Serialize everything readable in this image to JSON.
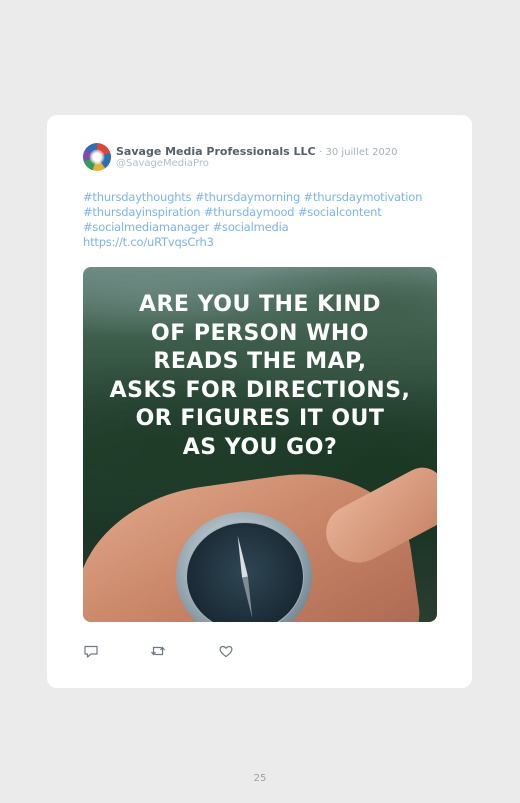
{
  "tweet": {
    "author_name": "Savage Media Professionals LLC",
    "date": "· 30 juillet 2020",
    "handle": "@SavageMediaPro",
    "text_lines": [
      "#thursdaythoughts #thursdaymorning #thursdaymotivation",
      "#thursdayinspiration #thursdaymood #socialcontent",
      "#socialmediamanager #socialmedia",
      "https://t.co/uRTvqsCrh3"
    ],
    "image_caption_lines": [
      "ARE YOU THE KIND",
      "OF PERSON WHO",
      "READS THE MAP,",
      "ASKS FOR DIRECTIONS,",
      "OR FIGURES IT OUT",
      "AS YOU GO?"
    ],
    "actions": {
      "reply_icon": "reply-icon",
      "retweet_icon": "retweet-icon",
      "like_icon": "heart-icon"
    }
  },
  "page_number": "25",
  "colors": {
    "page_background": "#ebebeb",
    "card_background": "#ffffff",
    "link": "#7db4e6",
    "icon": "#6d7882"
  }
}
